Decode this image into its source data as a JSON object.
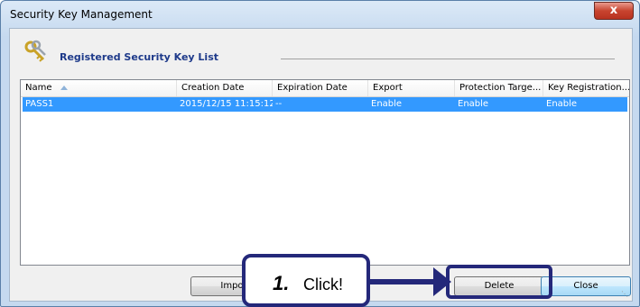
{
  "window": {
    "title": "Security Key Management",
    "close_glyph": "x"
  },
  "section": {
    "title": "Registered Security Key List",
    "icon": "keys-icon"
  },
  "list": {
    "columns": [
      "Name",
      "Creation Date",
      "Expiration Date",
      "Export",
      "Protection Targe...",
      "Key Registration..."
    ],
    "sort_column": "Name",
    "sort_direction": "ascending",
    "rows": [
      {
        "name": "PASS1",
        "creation_date": "2015/12/15 11:15:12",
        "expiration_date": "--",
        "export": "Enable",
        "protection_target": "Enable",
        "key_registration": "Enable",
        "selected": true
      }
    ]
  },
  "buttons": {
    "import_label": "Import",
    "delete_label": "Delete",
    "close_label": "Close"
  },
  "annotation": {
    "step_number": "1.",
    "step_text": "Click!",
    "color": "#24287a"
  },
  "colors": {
    "selection": "#3399ff",
    "section_title": "#1e3a8a"
  }
}
